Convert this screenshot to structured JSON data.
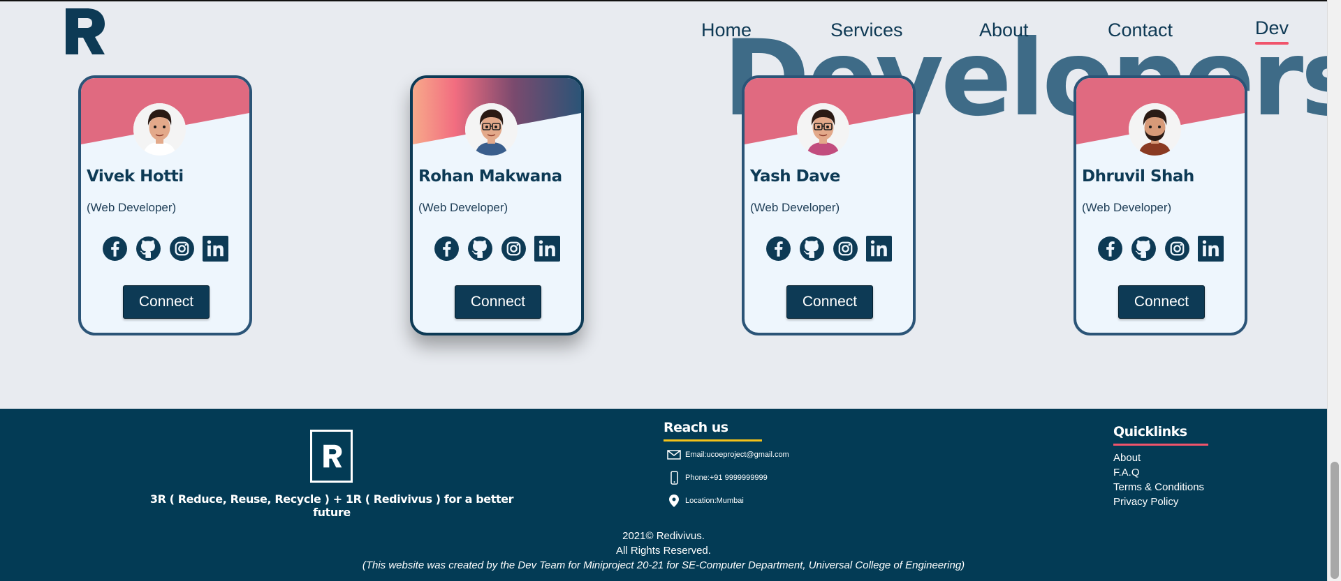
{
  "header": {
    "logo_icon": "r-logo-icon",
    "nav": [
      {
        "label": "Home",
        "active": false
      },
      {
        "label": "Services",
        "active": false
      },
      {
        "label": "About",
        "active": false
      },
      {
        "label": "Contact",
        "active": false
      },
      {
        "label": "Dev",
        "active": true
      }
    ]
  },
  "hero": {
    "heading": "Developers"
  },
  "cards": [
    {
      "name": "Vivek Hotti",
      "role": "(Web Developer)",
      "button": "Connect",
      "featured": false
    },
    {
      "name": "Rohan Makwana",
      "role": "(Web Developer)",
      "button": "Connect",
      "featured": true
    },
    {
      "name": "Yash Dave",
      "role": "(Web Developer)",
      "button": "Connect",
      "featured": false
    },
    {
      "name": "Dhruvil Shah",
      "role": "(Web Developer)",
      "button": "Connect",
      "featured": false
    }
  ],
  "social_icons": [
    "facebook-icon",
    "github-icon",
    "instagram-icon",
    "linkedin-icon"
  ],
  "footer": {
    "tagline": "3R ( Reduce, Reuse, Recycle ) + 1R ( Redivivus ) for a better future",
    "reach": {
      "title": "Reach us",
      "email": "Email:ucoeproject@gmail.com",
      "phone": "Phone:+91 9999999999",
      "location": "Location:Mumbai"
    },
    "quicklinks": {
      "title": "Quicklinks",
      "links": [
        "About",
        "F.A.Q",
        "Terms & Conditions",
        "Privacy Policy"
      ]
    },
    "copyright": "2021© Redivivus.",
    "rights": "All Rights Reserved.",
    "credit": "(This website was created by the Dev Team for Miniproject 20-21 for SE-Computer Department, Universal College of Engineering)"
  },
  "colors": {
    "navy": "#0d3a55",
    "footer_bg": "#033b55",
    "accent_pink": "#f0546b",
    "accent_yellow": "#f4c21a",
    "hero_text": "#3e6b87",
    "page_bg": "#e8ebf0"
  }
}
